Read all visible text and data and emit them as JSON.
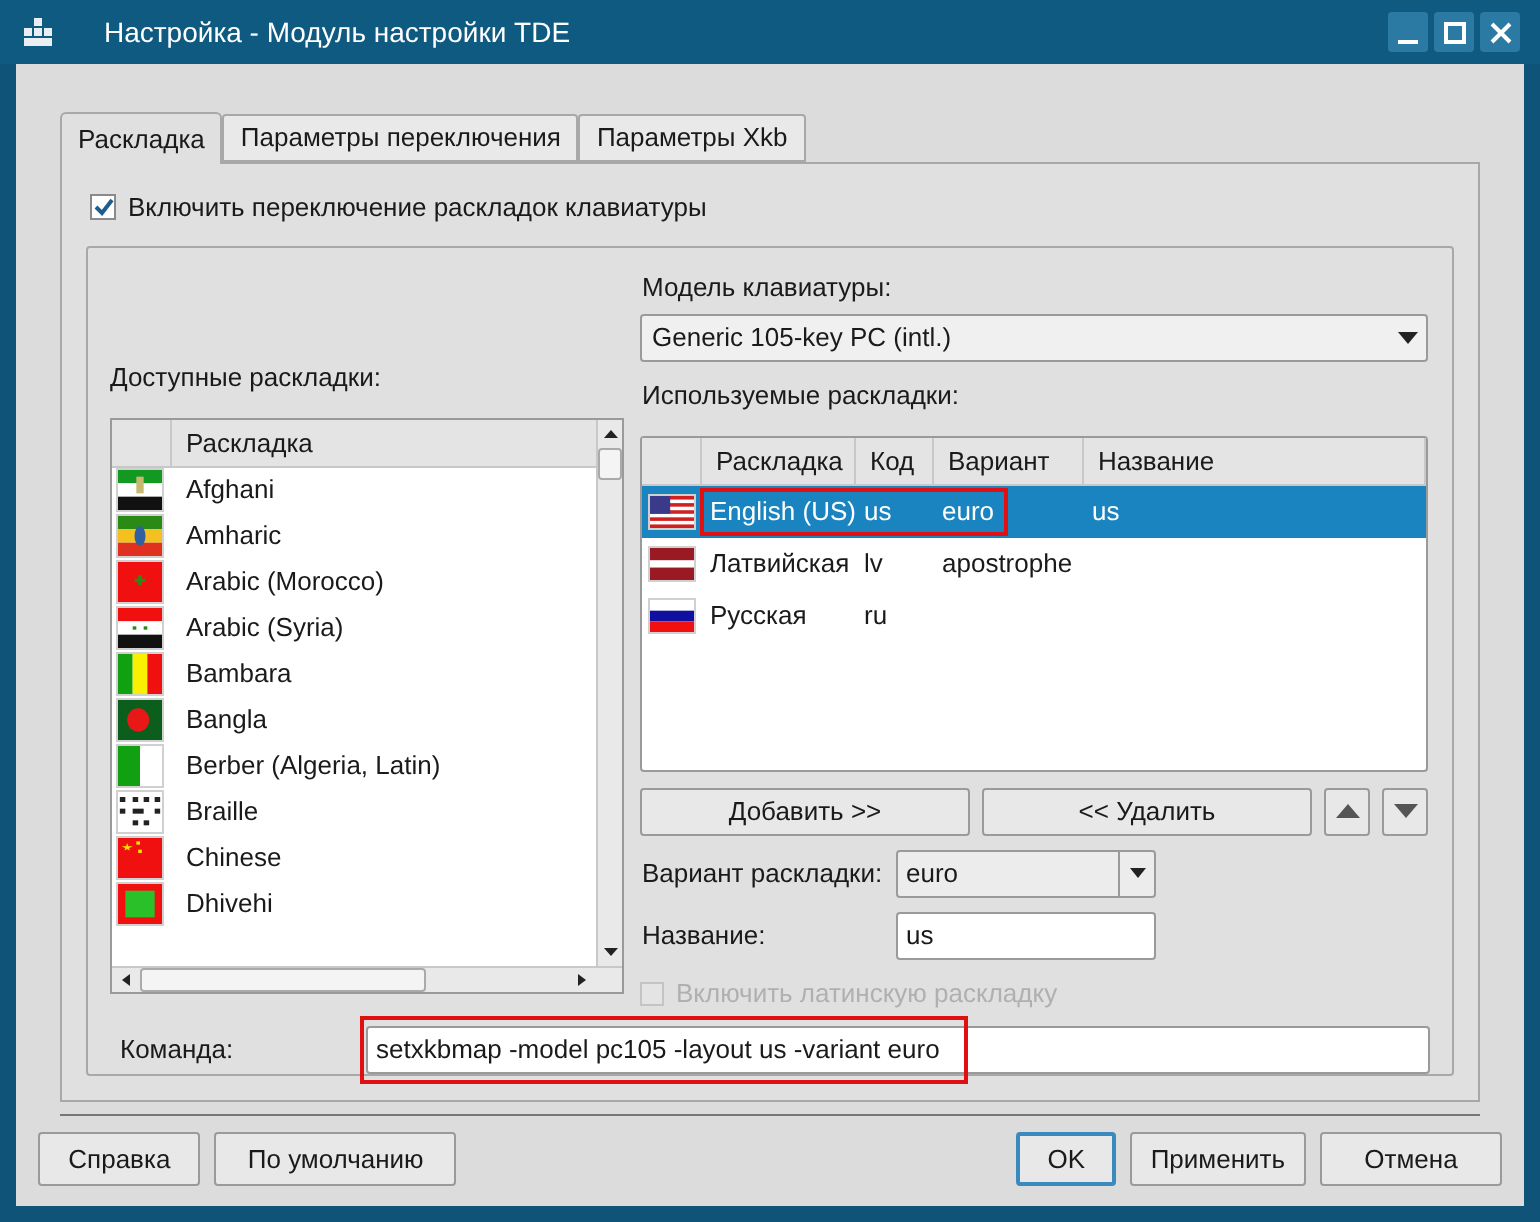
{
  "window": {
    "title": "Настройка - Модуль настройки TDE"
  },
  "tabs": [
    {
      "label": "Раскладка",
      "selected": true
    },
    {
      "label": "Параметры переключения",
      "selected": false
    },
    {
      "label": "Параметры Xkb",
      "selected": false
    }
  ],
  "enable_switching": {
    "label": "Включить переключение раскладок клавиатуры",
    "checked": true
  },
  "keyboard_model": {
    "label": "Модель клавиатуры:",
    "value": "Generic 105-key PC (intl.)"
  },
  "available": {
    "label": "Доступные раскладки:",
    "columns": [
      "Раскладка"
    ],
    "rows": [
      {
        "name": "Afghani"
      },
      {
        "name": "Amharic"
      },
      {
        "name": "Arabic (Morocco)"
      },
      {
        "name": "Arabic (Syria)"
      },
      {
        "name": "Bambara"
      },
      {
        "name": "Bangla"
      },
      {
        "name": "Berber (Algeria, Latin)"
      },
      {
        "name": "Braille"
      },
      {
        "name": "Chinese"
      },
      {
        "name": "Dhivehi"
      }
    ]
  },
  "active": {
    "label": "Используемые раскладки:",
    "columns": [
      "Раскладка",
      "Код",
      "Вариант",
      "Название"
    ],
    "rows": [
      {
        "cells": [
          "English (US)",
          "us",
          "euro",
          "us"
        ],
        "selected": true,
        "highlighted": true
      },
      {
        "cells": [
          "Латвийская",
          "lv",
          "apostrophe",
          ""
        ],
        "selected": false,
        "highlighted": false
      },
      {
        "cells": [
          "Русская",
          "ru",
          "",
          ""
        ],
        "selected": false,
        "highlighted": false
      }
    ]
  },
  "add_button": "Добавить >>",
  "remove_button": "<< Удалить",
  "variant": {
    "label": "Вариант раскладки:",
    "value": "euro"
  },
  "name": {
    "label": "Название:",
    "value": "us"
  },
  "latin": {
    "label": "Включить латинскую раскладку",
    "checked": false,
    "disabled": true
  },
  "command": {
    "label": "Команда:",
    "value": "setxkbmap -model pc105 -layout us -variant euro",
    "highlighted": true
  },
  "buttons": [
    {
      "label": "Справка",
      "default": false
    },
    {
      "label": "По умолчанию",
      "default": false
    },
    {
      "label": "OK",
      "default": true
    },
    {
      "label": "Применить",
      "default": false
    },
    {
      "label": "Отмена",
      "default": false
    }
  ]
}
